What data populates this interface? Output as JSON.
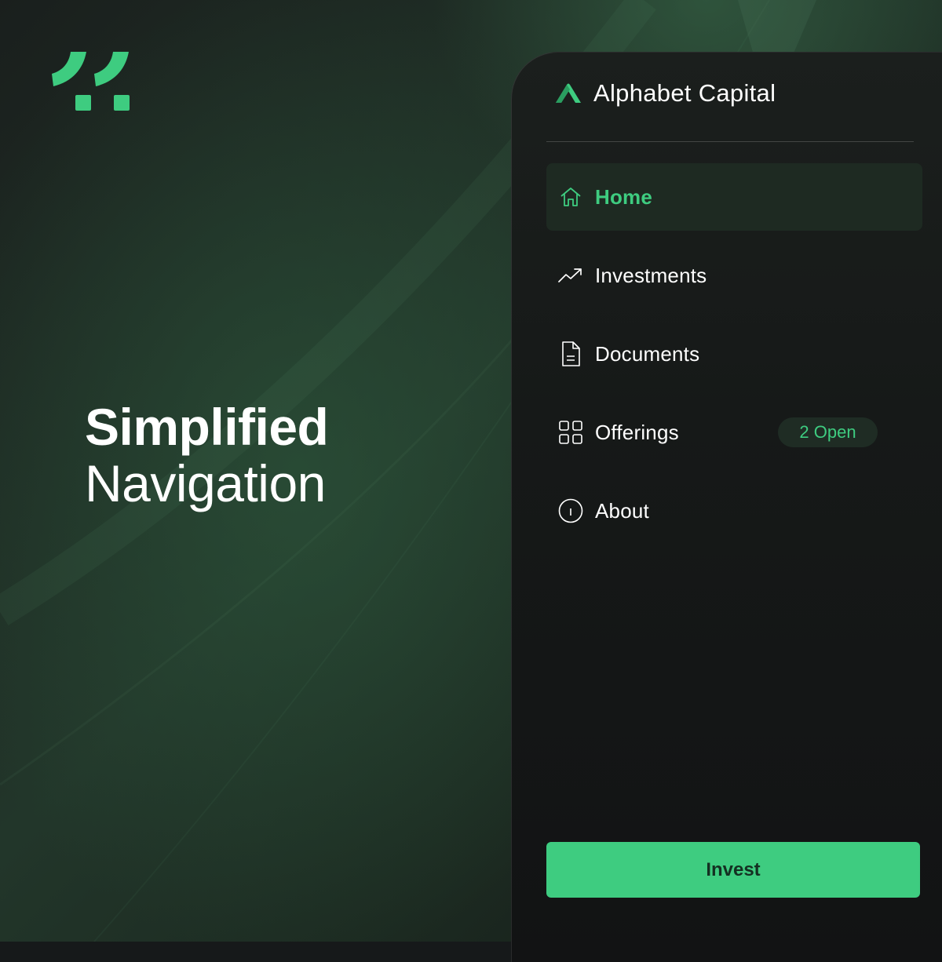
{
  "brand": {
    "mark_icon": "double-quote-mark-icon",
    "accent_color": "#3ecc80"
  },
  "hero": {
    "line1": "Simplified",
    "line2": "Navigation"
  },
  "app": {
    "logo_icon": "a-chevron-logo-icon",
    "title": "Alphabet Capital"
  },
  "nav": {
    "items": [
      {
        "label": "Home",
        "icon": "home-icon",
        "active": true
      },
      {
        "label": "Investments",
        "icon": "trending-up-icon",
        "active": false
      },
      {
        "label": "Documents",
        "icon": "document-icon",
        "active": false
      },
      {
        "label": "Offerings",
        "icon": "grid-icon",
        "active": false,
        "badge": "2 Open"
      },
      {
        "label": "About",
        "icon": "info-icon",
        "active": false
      }
    ]
  },
  "cta": {
    "label": "Invest",
    "color": "#3ecc80"
  }
}
